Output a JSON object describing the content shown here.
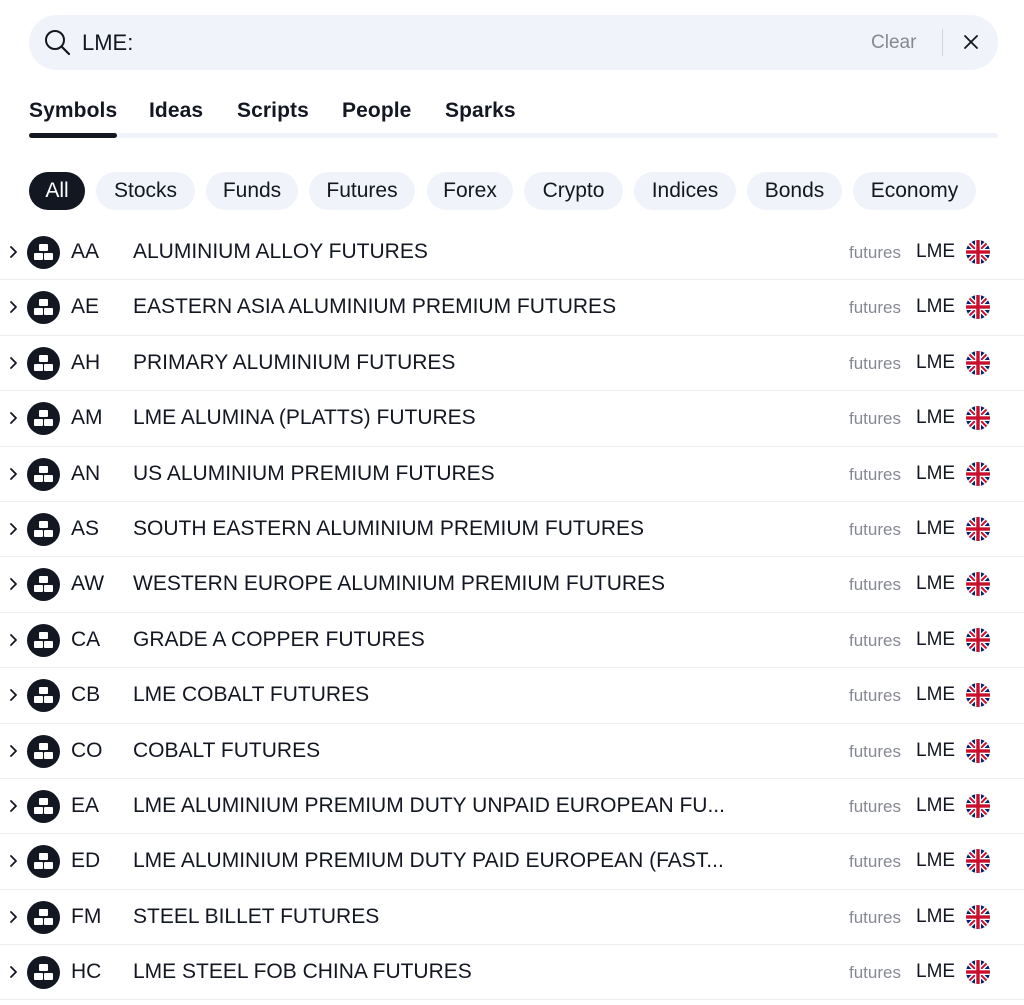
{
  "search": {
    "value": "LME:",
    "clear_label": "Clear"
  },
  "tabs": [
    {
      "label": "Symbols"
    },
    {
      "label": "Ideas"
    },
    {
      "label": "Scripts"
    },
    {
      "label": "People"
    },
    {
      "label": "Sparks"
    }
  ],
  "filters": [
    {
      "label": "All"
    },
    {
      "label": "Stocks"
    },
    {
      "label": "Funds"
    },
    {
      "label": "Futures"
    },
    {
      "label": "Forex"
    },
    {
      "label": "Crypto"
    },
    {
      "label": "Indices"
    },
    {
      "label": "Bonds"
    },
    {
      "label": "Economy"
    }
  ],
  "active_filter": "All",
  "colors": {
    "accent": "#131722",
    "muted": "#868993",
    "chip_bg": "#f0f3fa"
  },
  "results": [
    {
      "symbol": "AA",
      "description": "ALUMINIUM ALLOY FUTURES",
      "type": "futures",
      "exchange": "LME",
      "flag": "uk-flag-icon"
    },
    {
      "symbol": "AE",
      "description": "EASTERN ASIA ALUMINIUM PREMIUM FUTURES",
      "type": "futures",
      "exchange": "LME",
      "flag": "uk-flag-icon"
    },
    {
      "symbol": "AH",
      "description": "PRIMARY ALUMINIUM FUTURES",
      "type": "futures",
      "exchange": "LME",
      "flag": "uk-flag-icon"
    },
    {
      "symbol": "AM",
      "description": "LME ALUMINA (PLATTS)  FUTURES",
      "type": "futures",
      "exchange": "LME",
      "flag": "uk-flag-icon"
    },
    {
      "symbol": "AN",
      "description": "US ALUMINIUM PREMIUM FUTURES",
      "type": "futures",
      "exchange": "LME",
      "flag": "uk-flag-icon"
    },
    {
      "symbol": "AS",
      "description": "SOUTH EASTERN ALUMINIUM PREMIUM FUTURES",
      "type": "futures",
      "exchange": "LME",
      "flag": "uk-flag-icon"
    },
    {
      "symbol": "AW",
      "description": "WESTERN EUROPE ALUMINIUM PREMIUM FUTURES",
      "type": "futures",
      "exchange": "LME",
      "flag": "uk-flag-icon"
    },
    {
      "symbol": "CA",
      "description": "GRADE A COPPER FUTURES",
      "type": "futures",
      "exchange": "LME",
      "flag": "uk-flag-icon"
    },
    {
      "symbol": "CB",
      "description": "LME COBALT FUTURES",
      "type": "futures",
      "exchange": "LME",
      "flag": "uk-flag-icon"
    },
    {
      "symbol": "CO",
      "description": "COBALT FUTURES",
      "type": "futures",
      "exchange": "LME",
      "flag": "uk-flag-icon"
    },
    {
      "symbol": "EA",
      "description": "LME ALUMINIUM PREMIUM DUTY UNPAID EUROPEAN FU...",
      "type": "futures",
      "exchange": "LME",
      "flag": "uk-flag-icon"
    },
    {
      "symbol": "ED",
      "description": "LME ALUMINIUM PREMIUM DUTY PAID EUROPEAN (FAST...",
      "type": "futures",
      "exchange": "LME",
      "flag": "uk-flag-icon"
    },
    {
      "symbol": "FM",
      "description": "STEEL BILLET FUTURES",
      "type": "futures",
      "exchange": "LME",
      "flag": "uk-flag-icon"
    },
    {
      "symbol": "HC",
      "description": "LME STEEL FOB CHINA FUTURES",
      "type": "futures",
      "exchange": "LME",
      "flag": "uk-flag-icon"
    }
  ]
}
